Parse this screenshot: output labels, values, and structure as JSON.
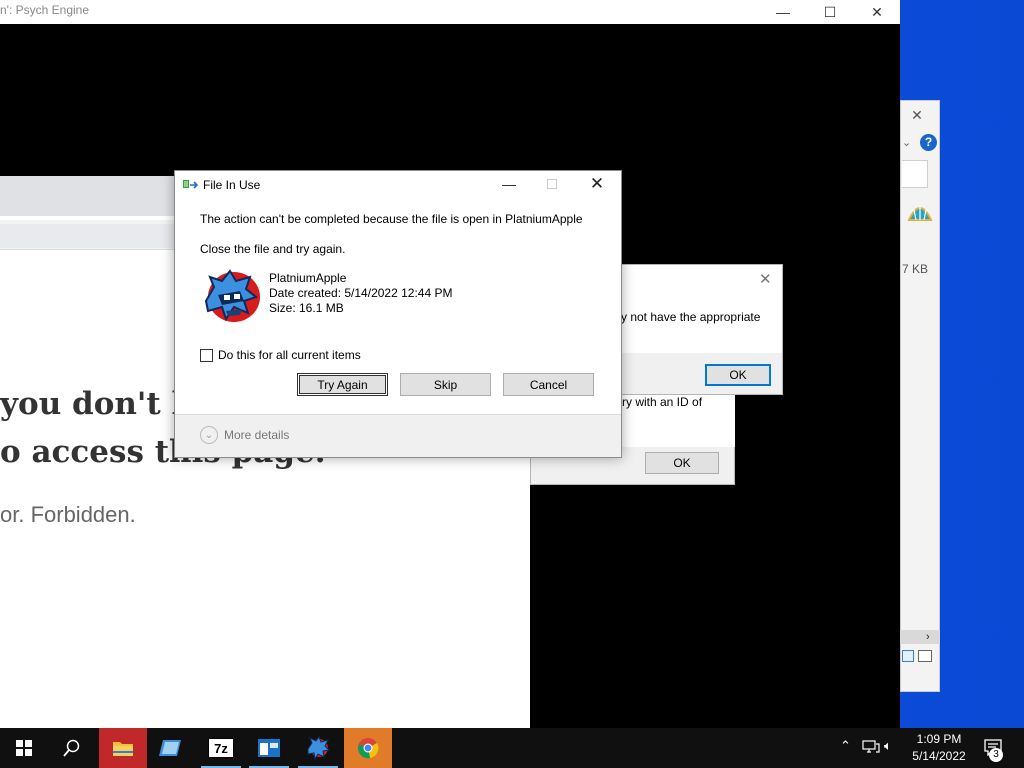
{
  "psych_window": {
    "title": "n': Psych Engine"
  },
  "caption_buttons": {
    "minimize": "—",
    "maximize": "☐",
    "close": "✕"
  },
  "explorer": {
    "size_text": "7 KB"
  },
  "browser_page": {
    "error_line1": "you don't h",
    "error_line2": "o access this page.",
    "error_sub": "or. Forbidden."
  },
  "error_dialog_1": {
    "text": "y not have the appropriate",
    "ok_label": "OK"
  },
  "error_dialog_2": {
    "text": "ry with an ID of",
    "ok_label": "OK"
  },
  "file_in_use_dialog": {
    "title": "File In Use",
    "message": "The action can't be completed because the file is open in PlatniumApple",
    "instruction": "Close the file and try again.",
    "file": {
      "name": "PlatniumApple",
      "date_created": "Date created: 5/14/2022 12:44 PM",
      "size": "Size: 16.1 MB"
    },
    "checkbox_label": "Do this for all current items",
    "checkbox_checked": false,
    "buttons": {
      "try_again": "Try Again",
      "skip": "Skip",
      "cancel": "Cancel"
    },
    "more_details": "More details"
  },
  "taskbar": {
    "apps": [
      "start",
      "search",
      "file-explorer",
      "file-manager",
      "7zip",
      "window-app",
      "fnf-game",
      "chrome"
    ],
    "clock_time": "1:09 PM",
    "clock_date": "5/14/2022",
    "notification_count": "3"
  },
  "colors": {
    "desktop": "#0b3fb8",
    "accent": "#0078d7",
    "taskbar": "#101010"
  }
}
